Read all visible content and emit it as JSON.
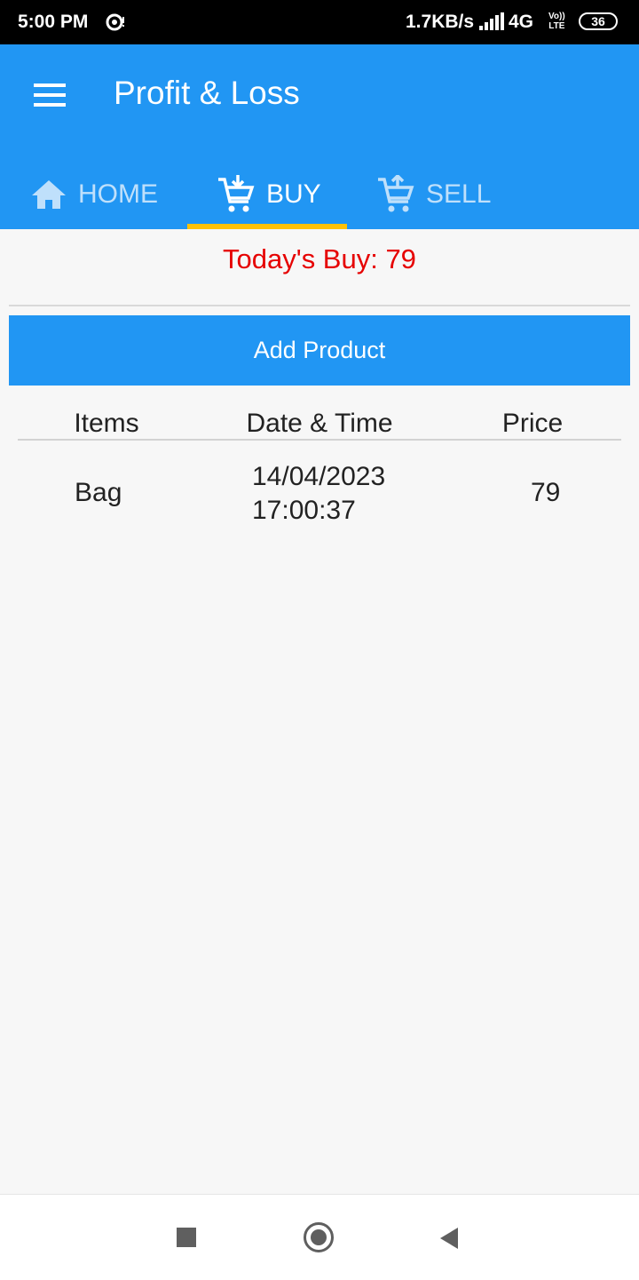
{
  "status_bar": {
    "time": "5:00 PM",
    "speed": "1.7KB/s",
    "network": "4G",
    "volte_top": "Vo))",
    "volte_bottom": "LTE",
    "battery": "36"
  },
  "app_bar": {
    "title": "Profit & Loss",
    "tabs": [
      {
        "label": "HOME",
        "icon": "home-icon",
        "active": false
      },
      {
        "label": "BUY",
        "icon": "cart-download-icon",
        "active": true
      },
      {
        "label": "SELL",
        "icon": "cart-upload-icon",
        "active": false
      }
    ]
  },
  "summary": {
    "todays_buy": "Today's Buy: 79"
  },
  "actions": {
    "add_product_label": "Add Product"
  },
  "table": {
    "headers": [
      "Items",
      "Date & Time",
      "Price"
    ],
    "rows": [
      {
        "item": "Bag",
        "datetime": "14/04/2023 17:00:37",
        "price": "79"
      }
    ]
  },
  "colors": {
    "primary": "#2196f3",
    "tab_indicator": "#ffc107",
    "summary_text": "#e60000"
  }
}
